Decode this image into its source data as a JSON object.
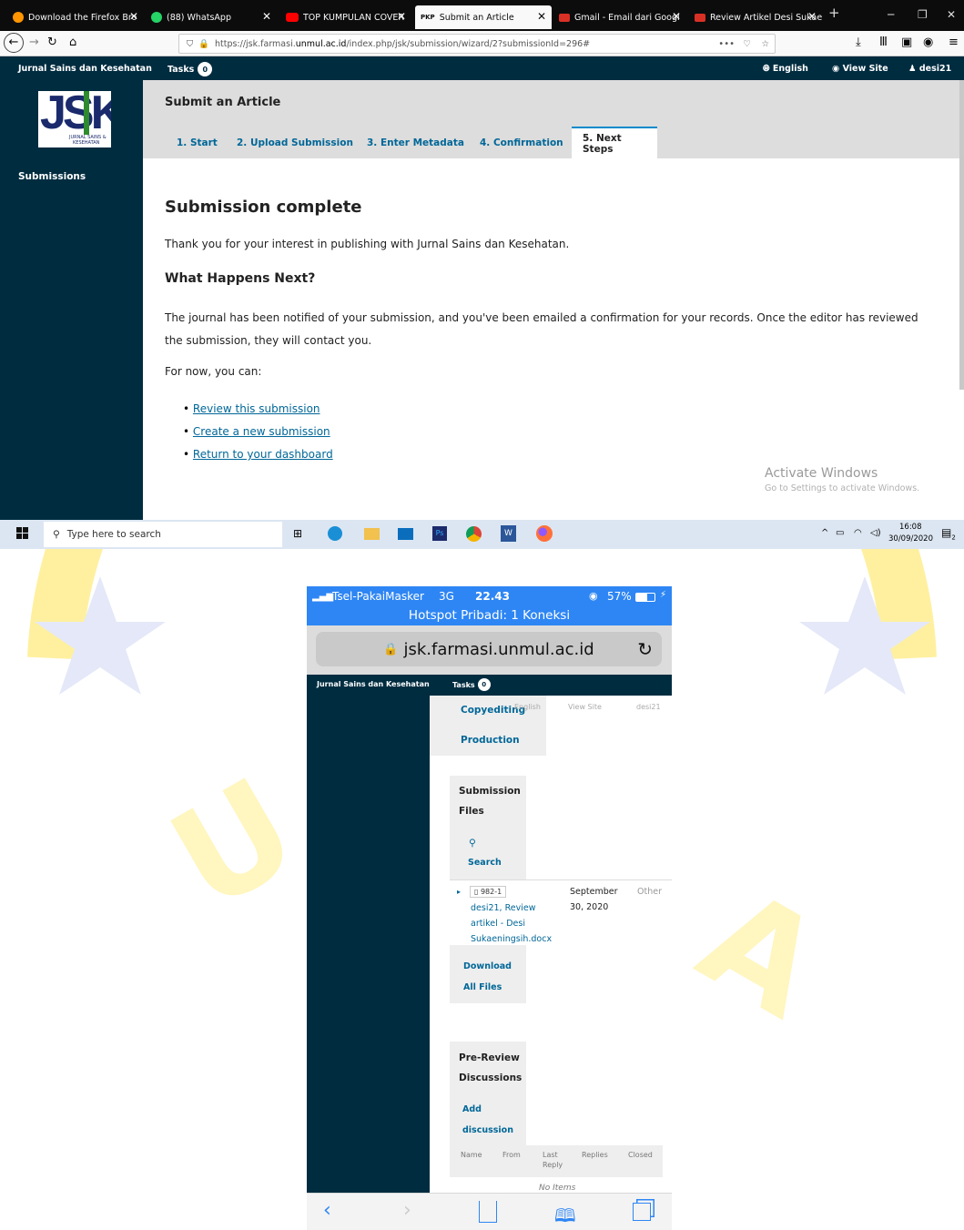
{
  "browser": {
    "tabs": [
      {
        "label": "Download the Firefox Bro",
        "icon": "firefox-icon",
        "color": "#ff9500"
      },
      {
        "label": "(88) WhatsApp",
        "icon": "whatsapp-icon",
        "color": "#25d366"
      },
      {
        "label": "TOP KUMPULAN COVER",
        "icon": "youtube-icon",
        "color": "#ff0000"
      },
      {
        "label": "Submit an Article",
        "icon": "pkp-icon",
        "color": "#555555"
      },
      {
        "label": "Gmail - Email dari Googl",
        "icon": "gmail-icon",
        "color": "#d93025"
      },
      {
        "label": "Review Artikel Desi Sukae",
        "icon": "gmail-icon",
        "color": "#d93025"
      }
    ],
    "pkp_badge": "PKP",
    "url_prefix": "https://jsk.farmasi.",
    "url_domain": "unmul.ac.id",
    "url_path": "/index.php/jsk/submission/wizard/2?submissionId=296#",
    "menu_dots": "•••"
  },
  "ojs": {
    "journal_name": "Jurnal Sains dan Kesehatan",
    "tasks_label": "Tasks",
    "tasks_count": "0",
    "language": "English",
    "view_site": "View Site",
    "username": "desi21",
    "logo_text": "JSK",
    "logo_sub1": "JURNAL SAINS &",
    "logo_sub2": "KESEHATAN",
    "nav_submissions": "Submissions",
    "page_title": "Submit an Article",
    "steps": [
      "1. Start",
      "2. Upload Submission",
      "3. Enter Metadata",
      "4. Confirmation",
      "5. Next Steps"
    ],
    "heading": "Submission complete",
    "thank_you": "Thank you for your interest in publishing with Jurnal Sains dan Kesehatan.",
    "subheading": "What Happens Next?",
    "notified_text": "The journal has been notified of your submission, and you've been emailed a confirmation for your records. Once the editor has reviewed the submission, they will contact you.",
    "for_now": "For now, you can:",
    "links": [
      "Review this submission",
      "Create a new submission",
      "Return to your dashboard"
    ],
    "activate_title": "Activate Windows",
    "activate_sub": "Go to Settings to activate Windows."
  },
  "taskbar": {
    "search_placeholder": "Type here to search",
    "time": "16:08",
    "date": "30/09/2020",
    "notif_count": "2"
  },
  "phone": {
    "carrier": "Tsel-PakaiMasker",
    "network": "3G",
    "time": "22.43",
    "battery": "57%",
    "hotspot": "Hotspot Pribadi: 1 Koneksi",
    "url": "jsk.farmasi.unmul.ac.id",
    "journal_name": "Jurnal Sains dan Kesehatan",
    "tasks_label": "Tasks",
    "tasks_count": "0",
    "ghost_english": "English",
    "ghost_view_site": "View Site",
    "ghost_user": "desi21",
    "copyediting": "Copyediting",
    "production": "Production",
    "submission_files_1": "Submission",
    "submission_files_2": "Files",
    "search": "Search",
    "file_id": "982-1",
    "file_name_1": "desi21, Review",
    "file_name_2": "artikel - Desi",
    "file_name_3": "Sukaeningsih.docx",
    "file_date_1": "September",
    "file_date_2": "30, 2020",
    "file_type": "Other",
    "download_1": "Download",
    "download_2": "All Files",
    "prereview_1": "Pre-Review",
    "prereview_2": "Discussions",
    "add_1": "Add",
    "add_2": "discussion",
    "col_name": "Name",
    "col_from": "From",
    "col_last_1": "Last",
    "col_last_2": "Reply",
    "col_replies": "Replies",
    "col_closed": "Closed",
    "no_items": "No Items"
  },
  "colors": {
    "ojs_navy": "#002c40",
    "ojs_link": "#006798",
    "ios_blue": "#2e86f4",
    "watermark_yellow": "#fff4b0",
    "watermark_blue": "#dde3f5"
  }
}
